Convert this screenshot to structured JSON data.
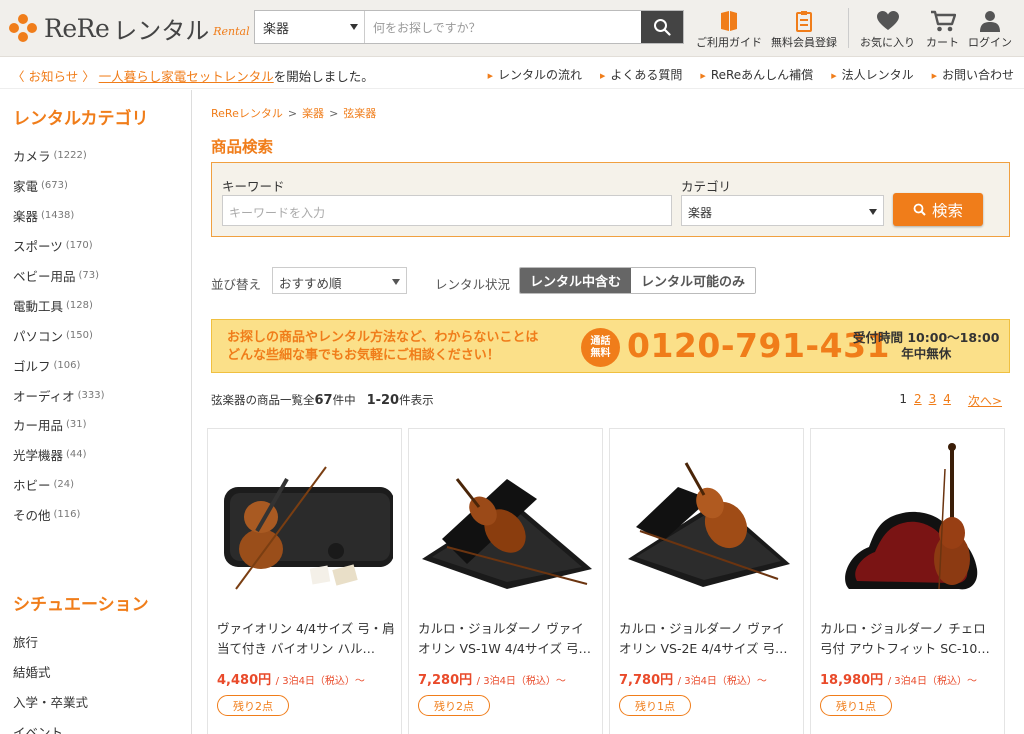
{
  "brand": {
    "name_latin": "ReRe",
    "name_kana": "レンタル",
    "script": "Rental"
  },
  "search": {
    "category": "楽器",
    "placeholder": "何をお探しですか？"
  },
  "header_nav": [
    {
      "label": "ご利用ガイド",
      "icon": "book-icon"
    },
    {
      "label": "無料会員登録",
      "icon": "clipboard-icon"
    },
    {
      "label": "お気に入り",
      "icon": "heart-icon"
    },
    {
      "label": "カート",
      "icon": "cart-icon"
    },
    {
      "label": "ログイン",
      "icon": "user-icon"
    }
  ],
  "notice": {
    "tag": "〈 お知らせ 〉",
    "link": "一人暮らし家電セットレンタル",
    "text": "を開始しました。"
  },
  "utility_links": [
    "レンタルの流れ",
    "よくある質問",
    "ReReあんしん補償",
    "法人レンタル",
    "お問い合わせ"
  ],
  "sidebar": {
    "categories_title": "レンタルカテゴリ",
    "categories": [
      {
        "name": "カメラ",
        "count": "(1222)"
      },
      {
        "name": "家電",
        "count": "(673)"
      },
      {
        "name": "楽器",
        "count": "(1438)"
      },
      {
        "name": "スポーツ",
        "count": "(170)"
      },
      {
        "name": "ベビー用品",
        "count": "(73)"
      },
      {
        "name": "電動工具",
        "count": "(128)"
      },
      {
        "name": "パソコン",
        "count": "(150)"
      },
      {
        "name": "ゴルフ",
        "count": "(106)"
      },
      {
        "name": "オーディオ",
        "count": "(333)"
      },
      {
        "name": "カー用品",
        "count": "(31)"
      },
      {
        "name": "光学機器",
        "count": "(44)"
      },
      {
        "name": "ホビー",
        "count": "(24)"
      },
      {
        "name": "その他",
        "count": "(116)"
      }
    ],
    "situations_title": "シチュエーション",
    "situations": [
      "旅行",
      "結婚式",
      "入学・卒業式",
      "イベント"
    ]
  },
  "breadcrumb": [
    "ReReレンタル",
    "楽器",
    "弦楽器"
  ],
  "product_search": {
    "title": "商品検索",
    "keyword_label": "キーワード",
    "keyword_placeholder": "キーワードを入力",
    "category_label": "カテゴリ",
    "category_value": "楽器",
    "button": "検索"
  },
  "sort": {
    "label": "並び替え",
    "value": "おすすめ順"
  },
  "rental_status": {
    "label": "レンタル状況",
    "options": [
      "レンタル中含む",
      "レンタル可能のみ"
    ],
    "selected": 0
  },
  "banner": {
    "line1": "お探しの商品やレンタル方法など、わからないことは",
    "line2": "どんな些細な事でもお気軽にご相談ください！",
    "badge1": "通話",
    "badge2": "無料",
    "phone": "0120-791-431",
    "hours_line1": "受付時間 10:00〜18:00",
    "hours_line2": "年中無休"
  },
  "results": {
    "prefix": "弦楽器の商品一覧全",
    "total": "67",
    "mid": "件中",
    "range": "1-20",
    "suffix": "件表示"
  },
  "pager": {
    "current": "1",
    "pages": [
      "2",
      "3",
      "4"
    ],
    "next": "次へ>"
  },
  "products": [
    {
      "name": "ヴァイオリン 4/4サイズ 弓・肩当て付き バイオリン ハル…",
      "price": "4,480円",
      "unit": "/ 3泊4日（税込）〜",
      "stock": "残り2点"
    },
    {
      "name": "カルロ・ジョルダーノ ヴァイオリン VS-1W 4/4サイズ 弓…",
      "price": "7,280円",
      "unit": "/ 3泊4日（税込）〜",
      "stock": "残り2点"
    },
    {
      "name": "カルロ・ジョルダーノ ヴァイオリン VS-2E 4/4サイズ 弓…",
      "price": "7,780円",
      "unit": "/ 3泊4日（税込）〜",
      "stock": "残り1点"
    },
    {
      "name": "カルロ・ジョルダーノ チェロ 弓付 アウトフィット SC-10…",
      "price": "18,980円",
      "unit": "/ 3泊4日（税込）〜",
      "stock": "残り1点"
    }
  ],
  "colors": {
    "accent": "#f07d1a",
    "price": "#e94a2a",
    "banner_bg": "#fbe089",
    "header_bg": "#f1efeb"
  }
}
